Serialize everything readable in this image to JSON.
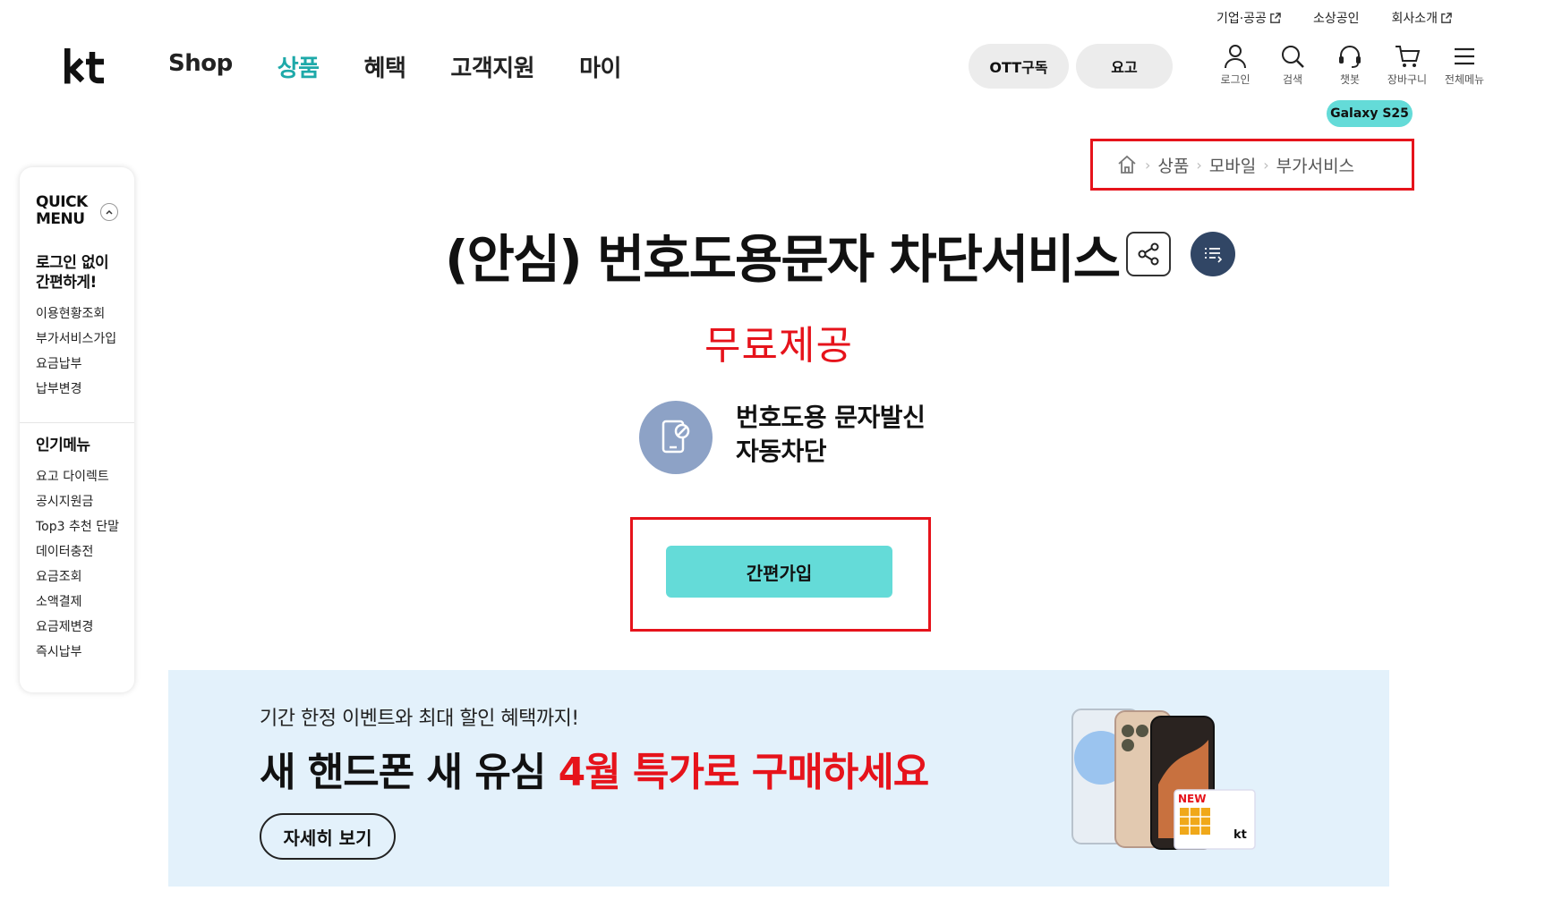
{
  "util_links": [
    {
      "label": "기업·공공"
    },
    {
      "label": "소상공인"
    },
    {
      "label": "회사소개"
    }
  ],
  "nav": {
    "items": [
      {
        "label": "Shop"
      },
      {
        "label": "상품"
      },
      {
        "label": "혜택"
      },
      {
        "label": "고객지원"
      },
      {
        "label": "마이"
      }
    ],
    "active": "상품"
  },
  "pills": {
    "ott": "OTT구독",
    "yogo": "요고"
  },
  "user_icons": [
    {
      "label": "로그인",
      "icon": "person-icon"
    },
    {
      "label": "검색",
      "icon": "search-icon"
    },
    {
      "label": "챗봇",
      "icon": "headset-icon"
    },
    {
      "label": "장바구니",
      "icon": "cart-icon"
    },
    {
      "label": "전체메뉴",
      "icon": "hamburger-icon"
    }
  ],
  "galaxy_tag": "Galaxy S25",
  "breadcrumb": {
    "items": [
      "상품",
      "모바일",
      "부가서비스"
    ]
  },
  "quick_menu": {
    "title_line1": "QUICK",
    "title_line2": "MENU",
    "section1_title_line1": "로그인 없이",
    "section1_title_line2": "간편하게!",
    "section1_items": [
      "이용현황조회",
      "부가서비스가입",
      "요금납부",
      "납부변경"
    ],
    "section2_title": "인기메뉴",
    "section2_items": [
      "요고 다이렉트",
      "공시지원금",
      "Top3 추천 단말",
      "데이터충전",
      "요금조회",
      "소액결제",
      "요금제변경",
      "즉시납부"
    ]
  },
  "product": {
    "title": "(안심) 번호도용문자 차단서비스",
    "price": "무료제공",
    "feature_line1": "번호도용 문자발신",
    "feature_line2": "자동차단",
    "join_label": "간편가입"
  },
  "banner": {
    "subtitle": "기간 한정 이벤트와 최대 할인 혜택까지!",
    "title_part1": "새 핸드폰 새 유심 ",
    "title_highlight": "4월 특가로 구매하세요",
    "button": "자세히 보기",
    "sim_label": "NEW",
    "sim_brand": "kt"
  },
  "colors": {
    "accent": "#1ea9a9",
    "button_teal": "#64dbd8",
    "highlight_red": "#e6131b",
    "banner_bg": "#e3f1fb",
    "list_btn": "#314665"
  }
}
